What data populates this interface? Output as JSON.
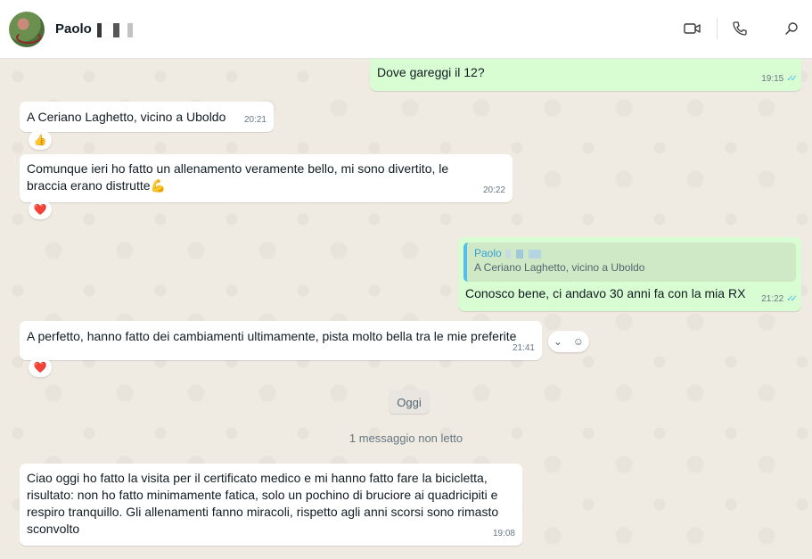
{
  "header": {
    "contact_name": "Paolo",
    "video_icon": "video-call-icon",
    "call_icon": "phone-icon",
    "search_icon": "search-icon"
  },
  "messages": [
    {
      "direction": "out",
      "text": "Dove gareggi il 12?",
      "time": "19:15",
      "status": "read"
    },
    {
      "direction": "in",
      "text": "A Ceriano Laghetto, vicino a Uboldo",
      "time": "20:21",
      "reaction": "👍"
    },
    {
      "direction": "in",
      "text": "Comunque ieri ho fatto un allenamento veramente bello, mi sono divertito, le braccia erano distrutte💪",
      "time": "20:22",
      "reaction": "❤️"
    },
    {
      "direction": "out",
      "quote_author": "Paolo",
      "quote_text": "A Ceriano Laghetto, vicino a Uboldo",
      "text": "Conosco bene, ci andavo 30 anni fa con la mia RX",
      "time": "21:22",
      "status": "read"
    },
    {
      "direction": "in",
      "text": "A perfetto, hanno fatto dei cambiamenti ultimamente, pista molto bella tra le mie preferite",
      "time": "21:41",
      "reaction": "❤️"
    },
    {
      "direction": "in",
      "text": "Ciao oggi ho fatto la visita per il certificato medico e mi hanno fatto fare la bicicletta, risultato: non ho fatto minimamente fatica, solo un pochino di bruciore ai quadricipiti e respiro tranquillo. Gli allenamenti fanno miracoli, rispetto agli anni scorsi sono rimasto sconvolto",
      "time": "19:08"
    }
  ],
  "date_divider": "Oggi",
  "unread_divider": "1 messaggio non letto",
  "colors": {
    "incoming": "#ffffff",
    "outgoing": "#d9fdd3",
    "read_ticks": "#53bdeb",
    "background": "#efeae2"
  }
}
